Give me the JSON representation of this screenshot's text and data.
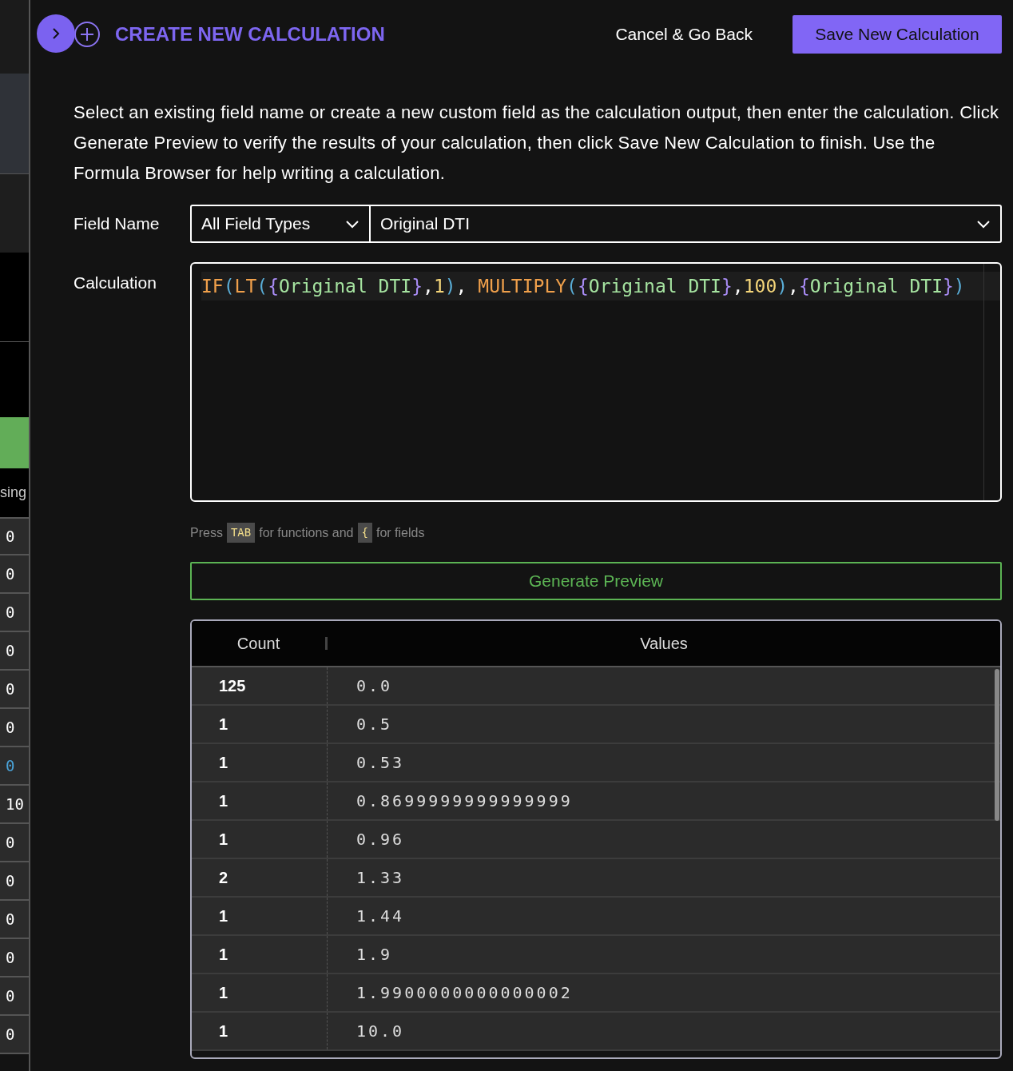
{
  "header": {
    "title": "CREATE NEW CALCULATION",
    "cancel": "Cancel & Go Back",
    "save": "Save New Calculation"
  },
  "side_strip": {
    "column_label": "sing",
    "values": [
      {
        "text": "0",
        "selected": false
      },
      {
        "text": "0",
        "selected": false
      },
      {
        "text": "0",
        "selected": false
      },
      {
        "text": "0",
        "selected": false
      },
      {
        "text": "0",
        "selected": false
      },
      {
        "text": "0",
        "selected": false
      },
      {
        "text": "0",
        "selected": true
      },
      {
        "text": "10",
        "selected": false
      },
      {
        "text": "0",
        "selected": false
      },
      {
        "text": "0",
        "selected": false
      },
      {
        "text": "0",
        "selected": false
      },
      {
        "text": "0",
        "selected": false
      },
      {
        "text": "0",
        "selected": false
      },
      {
        "text": "0",
        "selected": false
      }
    ]
  },
  "instructions": "Select an existing field name or create a new custom field as the calculation output, then enter the calculation. Click Generate Preview to verify the results of your calculation, then click Save New Calculation to finish. Use the Formula Browser for help writing a calculation.",
  "field_name": {
    "label": "Field Name",
    "type_filter": "All Field Types",
    "field": "Original DTI"
  },
  "calculation": {
    "label": "Calculation",
    "tokens": [
      {
        "kind": "function",
        "text": "IF"
      },
      {
        "kind": "paren",
        "text": "("
      },
      {
        "kind": "function",
        "text": "LT"
      },
      {
        "kind": "paren",
        "text": "("
      },
      {
        "kind": "brace",
        "text": "{"
      },
      {
        "kind": "field",
        "text": "Original DTI"
      },
      {
        "kind": "brace",
        "text": "}"
      },
      {
        "kind": "punct",
        "text": ","
      },
      {
        "kind": "number",
        "text": "1"
      },
      {
        "kind": "paren",
        "text": ")"
      },
      {
        "kind": "punct",
        "text": ", "
      },
      {
        "kind": "function",
        "text": "MULTIPLY"
      },
      {
        "kind": "paren",
        "text": "("
      },
      {
        "kind": "brace",
        "text": "{"
      },
      {
        "kind": "field",
        "text": "Original DTI"
      },
      {
        "kind": "brace",
        "text": "}"
      },
      {
        "kind": "punct",
        "text": ","
      },
      {
        "kind": "number",
        "text": "100"
      },
      {
        "kind": "paren",
        "text": ")"
      },
      {
        "kind": "punct",
        "text": ","
      },
      {
        "kind": "brace",
        "text": "{"
      },
      {
        "kind": "field",
        "text": "Original DTI"
      },
      {
        "kind": "brace",
        "text": "}"
      },
      {
        "kind": "paren",
        "text": ")"
      }
    ]
  },
  "hint": [
    {
      "kind": "text",
      "text": "Press"
    },
    {
      "kind": "key",
      "text": "TAB"
    },
    {
      "kind": "text",
      "text": "for functions and"
    },
    {
      "kind": "key",
      "text": "{"
    },
    {
      "kind": "text",
      "text": "for fields"
    }
  ],
  "generate_button": "Generate Preview",
  "preview": {
    "columns": [
      "Count",
      "Values"
    ],
    "rows": [
      {
        "count": "125",
        "value": "0.0"
      },
      {
        "count": "1",
        "value": "0.5"
      },
      {
        "count": "1",
        "value": "0.53"
      },
      {
        "count": "1",
        "value": "0.8699999999999999"
      },
      {
        "count": "1",
        "value": "0.96"
      },
      {
        "count": "2",
        "value": "1.33"
      },
      {
        "count": "1",
        "value": "1.44"
      },
      {
        "count": "1",
        "value": "1.9"
      },
      {
        "count": "1",
        "value": "1.9900000000000002"
      },
      {
        "count": "1",
        "value": "10.0"
      }
    ]
  }
}
